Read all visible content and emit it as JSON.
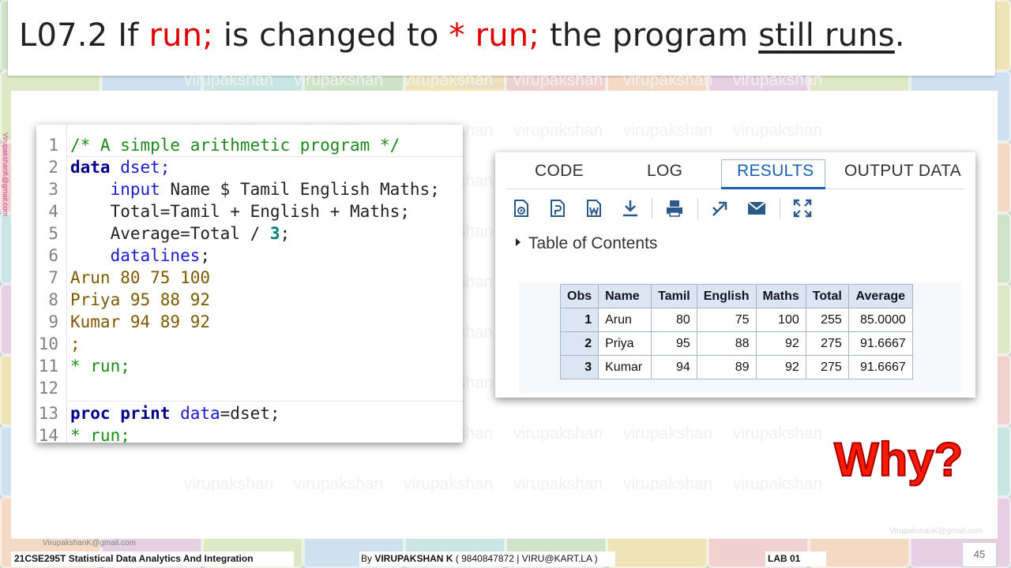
{
  "title": {
    "prefix": "L07.2  If  ",
    "run1": "run;",
    "mid": " is changed to ",
    "run2": "* run;",
    "suffix_a": "  the program ",
    "underlined": "still runs",
    "suffix_b": "."
  },
  "watermark": {
    "word": "virupakshan",
    "email": "VirupakshanK@gmail.com"
  },
  "code": {
    "lines": [
      {
        "n": "1",
        "text": "/* A simple arithmetic program */"
      },
      {
        "n": "2",
        "kw": "data",
        "rest": " dset;"
      },
      {
        "n": "3",
        "kw": "    input",
        "rest": " Name $ Tamil English Maths;"
      },
      {
        "n": "4",
        "text": "    Total=Tamil + English + Maths;"
      },
      {
        "n": "5",
        "pre": "    Average=Total / ",
        "num": "3",
        "post": ";"
      },
      {
        "n": "6",
        "kw": "    datalines",
        "rest": ";"
      },
      {
        "n": "7",
        "text": "Arun 80 75 100"
      },
      {
        "n": "8",
        "text": "Priya 95 88 92"
      },
      {
        "n": "9",
        "text": "Kumar 94 89 92"
      },
      {
        "n": "10",
        "text": ";"
      },
      {
        "n": "11",
        "text": "* run;"
      },
      {
        "n": "12",
        "text": ""
      },
      {
        "n": "13",
        "kw": "proc print",
        "mid": " data",
        "rest": "=dset;"
      },
      {
        "n": "14",
        "text": "* run;"
      }
    ]
  },
  "results": {
    "tabs": [
      "CODE",
      "LOG",
      "RESULTS",
      "OUTPUT DATA"
    ],
    "active_tab": "RESULTS",
    "toc_label": "Table of Contents",
    "table": {
      "headers": [
        "Obs",
        "Name",
        "Tamil",
        "English",
        "Maths",
        "Total",
        "Average"
      ],
      "rows": [
        [
          "1",
          "Arun",
          "80",
          "75",
          "100",
          "255",
          "85.0000"
        ],
        [
          "2",
          "Priya",
          "95",
          "88",
          "92",
          "275",
          "91.6667"
        ],
        [
          "3",
          "Kumar",
          "94",
          "89",
          "92",
          "275",
          "91.6667"
        ]
      ]
    }
  },
  "callout": "Why?",
  "footer": {
    "course": "21CSE295T Statistical Data Analytics And Integration",
    "author_prefix": "By ",
    "author_name": "VIRUPAKSHAN K",
    "author_suffix": " ( 9840847872 | VIRU@KART.LA )",
    "lab": "LAB  01",
    "page": "45"
  },
  "colors": {
    "accent_red": "#e00000",
    "tab_blue": "#1b5eb3",
    "why_red": "#ff1a00"
  }
}
